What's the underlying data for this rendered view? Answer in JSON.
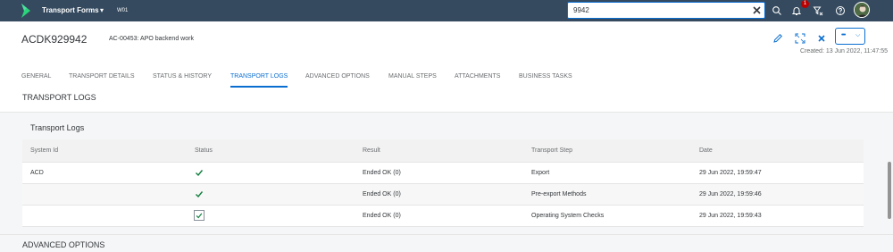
{
  "shell": {
    "app_title": "Transport Forms",
    "app_subtitle": "W01",
    "search_value": "9942",
    "notification_count": "1"
  },
  "header": {
    "object_title": "ACDK929942",
    "object_subtitle": "AC-00453: APO backend work",
    "created": "Created: 13 Jun 2022, 11:47:55",
    "more_label": "•••"
  },
  "tabs": [
    {
      "label": "GENERAL"
    },
    {
      "label": "TRANSPORT DETAILS"
    },
    {
      "label": "STATUS & HISTORY"
    },
    {
      "label": "TRANSPORT LOGS"
    },
    {
      "label": "ADVANCED OPTIONS"
    },
    {
      "label": "MANUAL STEPS"
    },
    {
      "label": "ATTACHMENTS"
    },
    {
      "label": "BUSINESS TASKS"
    }
  ],
  "section": {
    "title": "TRANSPORT LOGS",
    "card_title": "Transport Logs",
    "next_section": "ADVANCED OPTIONS"
  },
  "table": {
    "columns": [
      "System Id",
      "Status",
      "Result",
      "Transport Step",
      "Date"
    ],
    "rows": [
      {
        "system_id": "ACD",
        "result": "Ended OK (0)",
        "step": "Export",
        "date": "29 Jun 2022, 19:59:47"
      },
      {
        "system_id": "",
        "result": "Ended OK (0)",
        "step": "Pre-export Methods",
        "date": "29 Jun 2022, 19:59:46"
      },
      {
        "system_id": "",
        "result": "Ended OK (0)",
        "step": "Operating System Checks",
        "date": "29 Jun 2022, 19:59:43"
      }
    ]
  },
  "colors": {
    "shell": "#354a5f",
    "accent": "#0a6ed1",
    "success": "#107e3e",
    "badge": "#bb0000"
  }
}
